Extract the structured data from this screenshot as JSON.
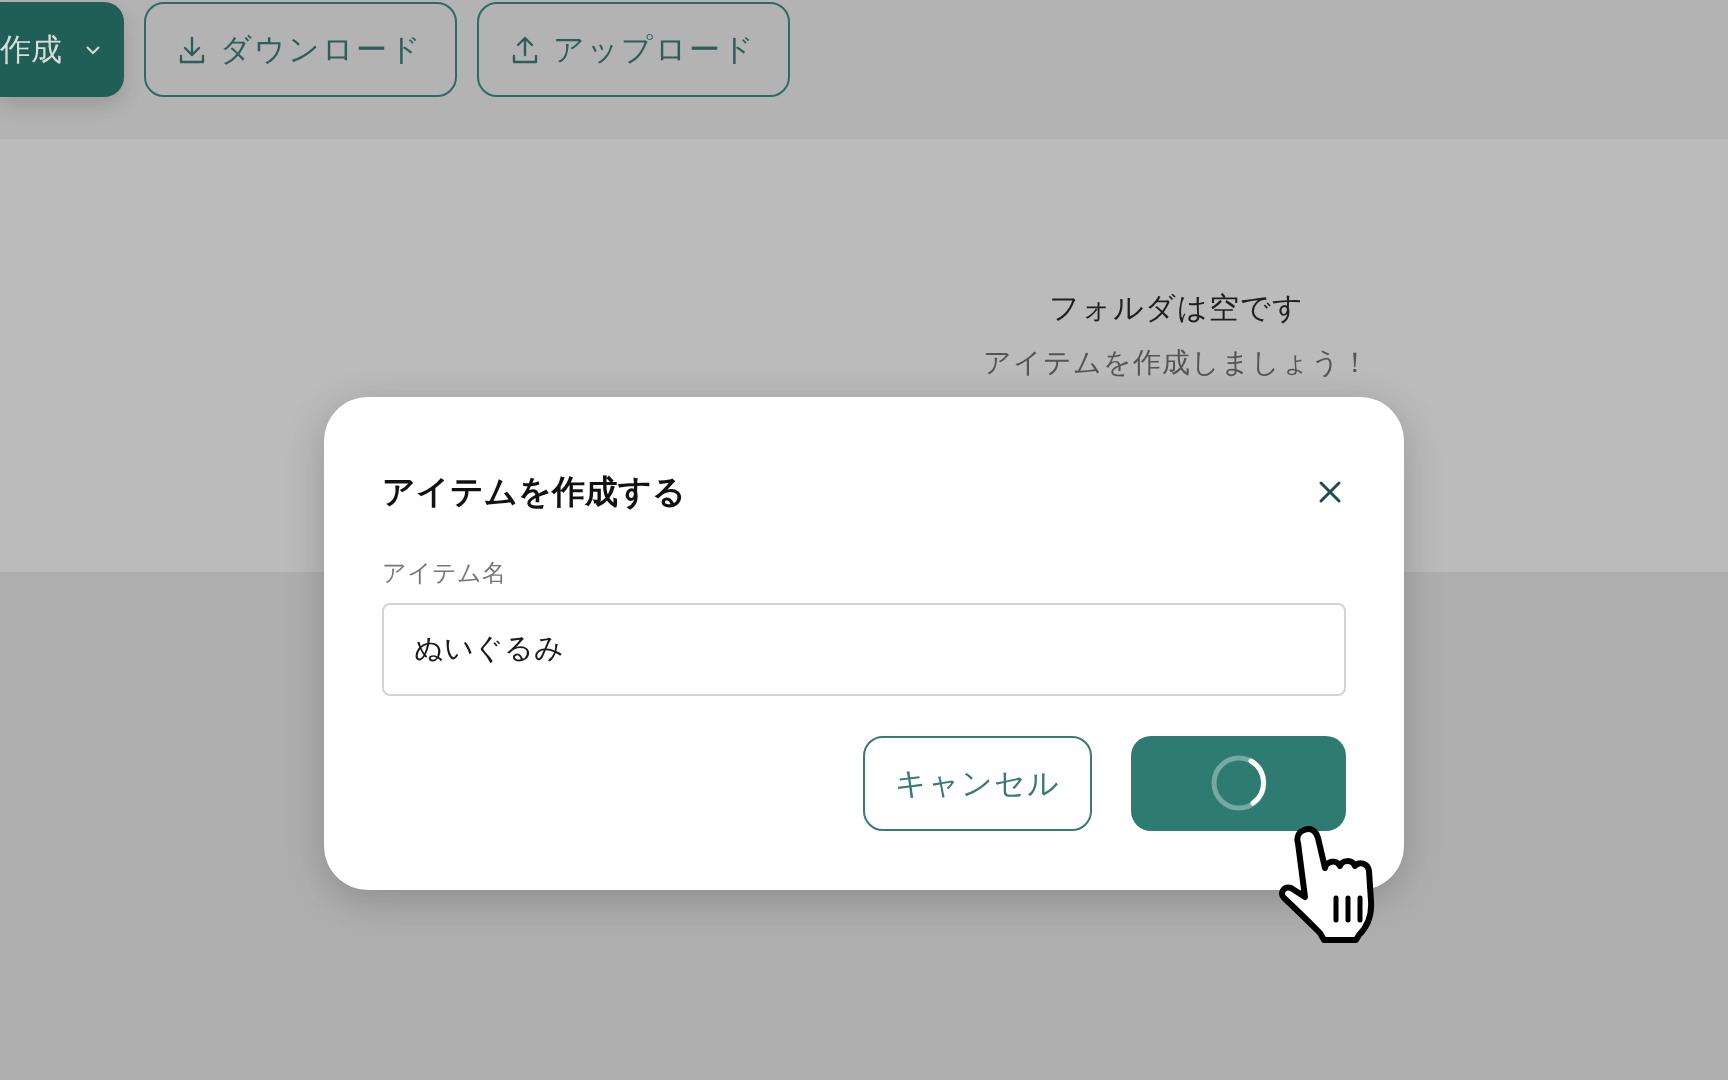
{
  "toolbar": {
    "buttons": [
      {
        "kind": "menu",
        "label": "作成"
      },
      {
        "kind": "download",
        "label": "ダウンロード"
      },
      {
        "kind": "upload",
        "label": "アップロード"
      }
    ]
  },
  "empty_state": {
    "title": "フォルダは空です",
    "message": "アイテムを作成しましょう！"
  },
  "dialog": {
    "title": "アイテムを作成する",
    "field": {
      "label": "アイテム名",
      "value": "ぬいぐるみ"
    },
    "cancel": "キャンセル",
    "submit": {
      "loading": true
    }
  }
}
